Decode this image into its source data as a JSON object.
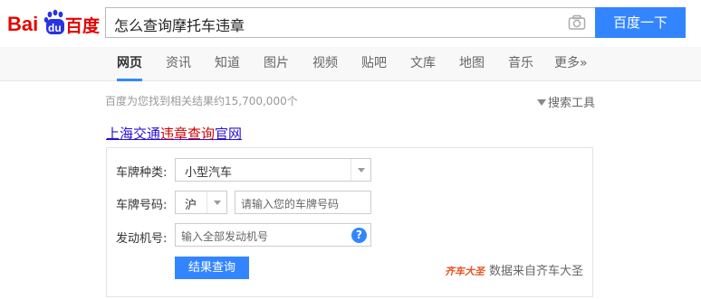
{
  "logo": {
    "text_left": "Bai",
    "text_mid": "du",
    "text_right": "百度"
  },
  "search": {
    "query": "怎么查询摩托车违章",
    "button_label": "百度一下"
  },
  "tabs": [
    {
      "label": "网页",
      "active": true
    },
    {
      "label": "资讯"
    },
    {
      "label": "知道"
    },
    {
      "label": "图片"
    },
    {
      "label": "视频"
    },
    {
      "label": "贴吧"
    },
    {
      "label": "文库"
    },
    {
      "label": "地图"
    },
    {
      "label": "音乐"
    },
    {
      "label": "更多»"
    }
  ],
  "results": {
    "stats": "百度为您找到相关结果约15,700,000个",
    "tools_label": "搜索工具",
    "title_pre": "上海交通",
    "title_em": "违章查询",
    "title_post": "官网"
  },
  "form": {
    "plate_type_label": "车牌种类:",
    "plate_type_value": "小型汽车",
    "plate_no_label": "车牌号码:",
    "province_value": "沪",
    "plate_no_placeholder": "请输入您的车牌号码",
    "engine_label": "发动机号:",
    "engine_placeholder": "输入全部发动机号",
    "help_symbol": "?",
    "submit_label": "结果查询",
    "source_logo": "齐车大圣",
    "source_text": "数据来自齐车大圣"
  },
  "colors": {
    "brand_blue": "#3385ff",
    "logo_red": "#e10601",
    "link_blue": "#2b0fd2",
    "em_red": "#cc0000"
  }
}
